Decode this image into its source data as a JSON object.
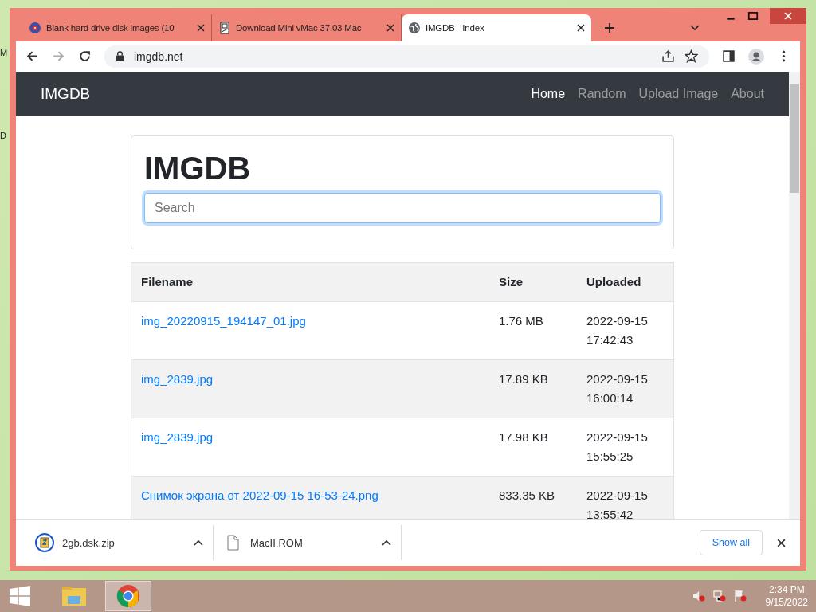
{
  "desktop_labels": [
    "M",
    "D"
  ],
  "tabs": [
    {
      "title": "Blank hard drive disk images (10",
      "selected": false
    },
    {
      "title": "Download Mini vMac 37.03 Mac",
      "selected": false
    },
    {
      "title": "IMGDB - Index",
      "selected": true
    }
  ],
  "address": "imgdb.net",
  "site": {
    "brand": "IMGDB",
    "nav": [
      {
        "label": "Home",
        "selected": true
      },
      {
        "label": "Random",
        "selected": false
      },
      {
        "label": "Upload Image",
        "selected": false
      },
      {
        "label": "About",
        "selected": false
      }
    ],
    "heading": "IMGDB",
    "search": {
      "placeholder": "Search"
    },
    "table": {
      "columns": [
        "Filename",
        "Size",
        "Uploaded"
      ],
      "rows": [
        {
          "filename": "img_20220915_194147_01.jpg",
          "size": "1.76 MB",
          "date": "2022-09-15",
          "time": "17:42:43"
        },
        {
          "filename": "img_2839.jpg",
          "size": "17.89 KB",
          "date": "2022-09-15",
          "time": "16:00:14"
        },
        {
          "filename": "img_2839.jpg",
          "size": "17.98 KB",
          "date": "2022-09-15",
          "time": "15:55:25"
        },
        {
          "filename": "Снимок экрана от 2022-09-15 16-53-24.png",
          "size": "833.35 KB",
          "date": "2022-09-15",
          "time": "13:55:42"
        }
      ]
    }
  },
  "downloads": [
    {
      "name": "2gb.dsk.zip",
      "kind": "zip"
    },
    {
      "name": "MacII.ROM",
      "kind": "file"
    }
  ],
  "show_all": "Show all",
  "taskbar": {
    "items": [
      {
        "kind": "folder",
        "selected": false
      },
      {
        "kind": "chrome",
        "selected": true
      }
    ],
    "time": "2:34 PM",
    "date": "9/15/2022"
  }
}
